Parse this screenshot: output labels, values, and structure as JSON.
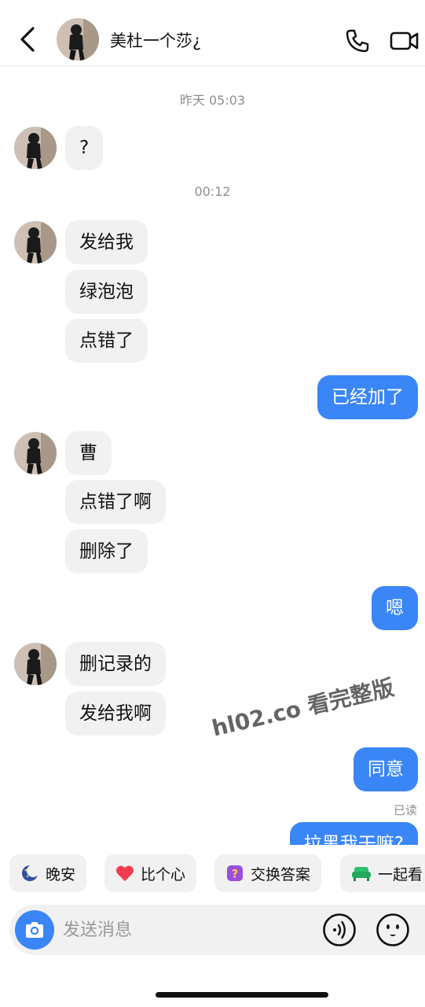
{
  "header": {
    "contact_name": "美杜一个莎¿",
    "back_icon": "chevron-left-icon",
    "call_icon": "phone-icon",
    "video_icon": "video-camera-icon"
  },
  "chat": {
    "timestamps": [
      "昨天 05:03",
      "00:12"
    ],
    "messages": [
      "?",
      "发给我",
      "绿泡泡",
      "点错了",
      "已经加了",
      "曹",
      "点错了啊",
      "删除了",
      "嗯",
      "删记录的",
      "发给我啊",
      "同意",
      "拉黑我干嘛?"
    ],
    "read_status": "已读"
  },
  "watermark": "hl02.co 看完整版",
  "quick_replies": [
    {
      "label": "晚安",
      "icon": "moon-icon"
    },
    {
      "label": "比个心",
      "icon": "heart-icon"
    },
    {
      "label": "交换答案",
      "icon": "question-box-icon"
    },
    {
      "label": "一起看",
      "icon": "sofa-icon"
    }
  ],
  "input": {
    "placeholder": "发送消息",
    "camera_icon": "camera-icon",
    "voice_icon": "voice-icon",
    "emoji_icon": "emoji-icon"
  },
  "colors": {
    "accent": "#3a86f7",
    "bubble_in": "#f1f1f1",
    "timestamp": "#8f8f8f"
  }
}
